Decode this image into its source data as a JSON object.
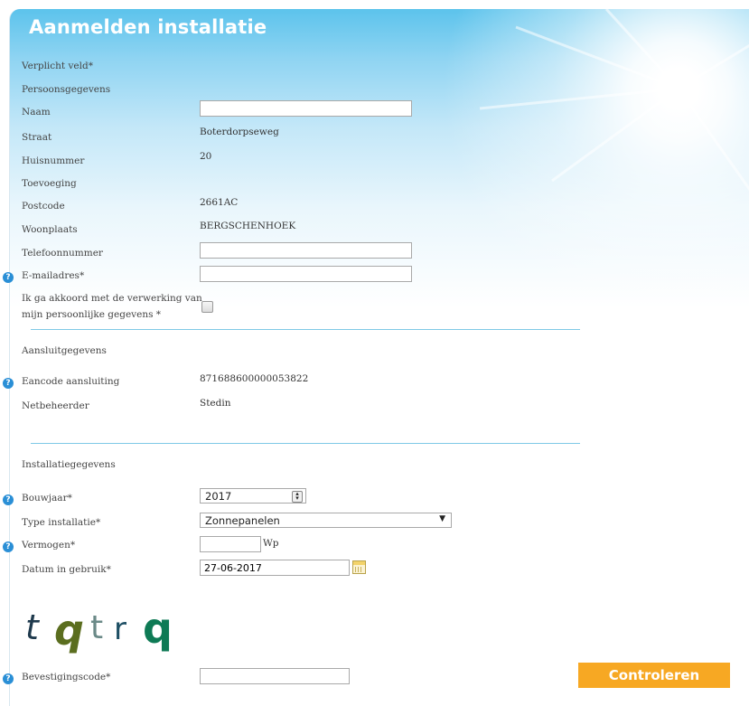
{
  "title": "Aanmelden installatie",
  "required_note": "Verplicht veld*",
  "personal": {
    "heading": "Persoonsgegevens",
    "naam_label": "Naam",
    "straat_label": "Straat",
    "straat_value": "Boterdorpseweg",
    "huisnummer_label": "Huisnummer",
    "huisnummer_value": "20",
    "toevoeging_label": "Toevoeging",
    "postcode_label": "Postcode",
    "postcode_value": "2661AC",
    "woonplaats_label": "Woonplaats",
    "woonplaats_value": "BERGSCHENHOEK",
    "telefoon_label": "Telefoonnummer",
    "email_label": "E-mailadres*",
    "akkoord_label_line1": "Ik ga akkoord met de verwerking van",
    "akkoord_label_line2": "mijn persoonlijke gegevens *"
  },
  "connection": {
    "heading": "Aansluitgegevens",
    "eancode_label": "Eancode aansluiting",
    "eancode_value": "871688600000053822",
    "netbeheerder_label": "Netbeheerder",
    "netbeheerder_value": "Stedin"
  },
  "installation": {
    "heading": "Installatiegegevens",
    "bouwjaar_label": "Bouwjaar*",
    "bouwjaar_value": "2017",
    "type_label": "Type installatie*",
    "type_value": "Zonnepanelen",
    "vermogen_label": "Vermogen*",
    "vermogen_unit": "Wp",
    "datum_label": "Datum in gebruik*",
    "datum_value": "27-06-2017"
  },
  "captcha": {
    "chars": [
      "t",
      "q",
      "t",
      "r",
      "q"
    ],
    "colors": [
      "#1f3a4d",
      "#5b6e1f",
      "#6b8a88",
      "#1e4f64",
      "#0e7a55"
    ],
    "label": "Bevestigingscode*"
  },
  "submit_label": "Controleren",
  "help_icon_glyph": "?",
  "colors": {
    "accent": "#f7a823",
    "help": "#2a8fd6",
    "divider": "#7fc9e6",
    "header": "#5cc3ec"
  }
}
